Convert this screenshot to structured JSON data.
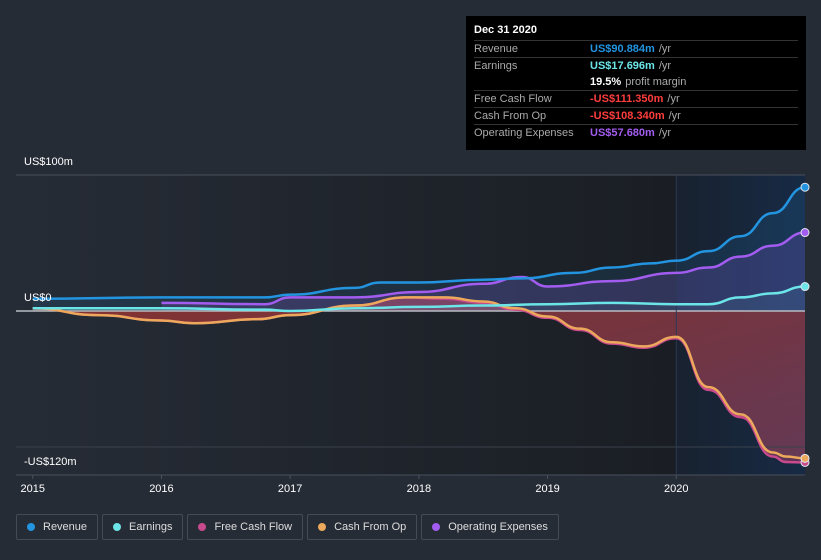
{
  "tooltip": {
    "date": "Dec 31 2020",
    "rows": [
      {
        "label": "Revenue",
        "value": "US$90.884m",
        "unit": "/yr",
        "color": "#2394df"
      },
      {
        "label": "Earnings",
        "value": "US$17.696m",
        "unit": "/yr",
        "color": "#6ce5e8"
      },
      {
        "label": "",
        "value": "19.5%",
        "unit": "profit margin",
        "color": "#ffffff"
      },
      {
        "label": "Free Cash Flow",
        "value": "-US$111.350m",
        "unit": "/yr",
        "color": "#ff3d3d"
      },
      {
        "label": "Cash From Op",
        "value": "-US$108.340m",
        "unit": "/yr",
        "color": "#ff3d3d"
      },
      {
        "label": "Operating Expenses",
        "value": "US$57.680m",
        "unit": "/yr",
        "color": "#a35cf0"
      }
    ]
  },
  "chart_data": {
    "type": "line",
    "title": "",
    "xlabel": "",
    "ylabel": "",
    "y_tick_labels": [
      "US$100m",
      "US$0",
      "-US$120m"
    ],
    "x_tick_labels": [
      "2015",
      "2016",
      "2017",
      "2018",
      "2019",
      "2020"
    ],
    "xlim": [
      2014.87,
      2021.0
    ],
    "ylim": [
      -120,
      100
    ],
    "forecast_shade_from": 2020.0,
    "series": [
      {
        "name": "Revenue",
        "color": "#2394df",
        "x": [
          2015.0,
          2016.0,
          2016.8,
          2017.0,
          2017.5,
          2017.7,
          2018.0,
          2018.5,
          2018.8,
          2019.2,
          2019.5,
          2019.8,
          2020.0,
          2020.25,
          2020.5,
          2020.75,
          2021.0
        ],
        "values": [
          9,
          10,
          10,
          12,
          17,
          21,
          21,
          23,
          24,
          28,
          32,
          35,
          37,
          44,
          55,
          72,
          91
        ]
      },
      {
        "name": "Earnings",
        "color": "#6ce5e8",
        "x": [
          2015.0,
          2016.0,
          2016.8,
          2017.0,
          2017.5,
          2018.0,
          2018.5,
          2019.0,
          2019.5,
          2020.0,
          2020.25,
          2020.5,
          2020.75,
          2021.0
        ],
        "values": [
          2,
          2,
          1,
          0,
          2,
          3,
          4,
          5,
          6,
          5,
          5,
          10,
          13,
          18
        ]
      },
      {
        "name": "Free Cash Flow",
        "color": "#c84a8c",
        "x": [
          2015.0,
          2015.5,
          2016.0,
          2016.25,
          2016.75,
          2017.0,
          2017.5,
          2017.9,
          2018.2,
          2018.5,
          2018.75,
          2019.0,
          2019.25,
          2019.5,
          2019.75,
          2020.0,
          2020.25,
          2020.5,
          2020.75,
          2020.85,
          2021.0
        ],
        "values": [
          2,
          -3,
          -7,
          -9,
          -6,
          -3,
          4,
          10,
          9,
          6,
          1,
          -5,
          -14,
          -24,
          -27,
          -20,
          -58,
          -78,
          -107,
          -111,
          -111.35
        ]
      },
      {
        "name": "Cash From Op",
        "color": "#eda95b",
        "x": [
          2015.0,
          2015.5,
          2016.0,
          2016.25,
          2016.75,
          2017.0,
          2017.5,
          2017.9,
          2018.2,
          2018.5,
          2018.75,
          2019.0,
          2019.25,
          2019.5,
          2019.75,
          2020.0,
          2020.25,
          2020.5,
          2020.75,
          2020.85,
          2021.0
        ],
        "values": [
          2,
          -3,
          -7,
          -9,
          -6,
          -3,
          4,
          10,
          10,
          7,
          2,
          -4,
          -13,
          -23,
          -26,
          -19,
          -56,
          -76,
          -104,
          -107,
          -108.34
        ]
      },
      {
        "name": "Operating Expenses",
        "color": "#a35cf0",
        "x": [
          2016.0,
          2016.8,
          2017.0,
          2017.5,
          2018.0,
          2018.5,
          2018.8,
          2019.0,
          2019.5,
          2020.0,
          2020.25,
          2020.5,
          2020.75,
          2021.0
        ],
        "values": [
          6,
          5,
          10,
          10,
          14,
          20,
          25,
          18,
          22,
          28,
          32,
          40,
          48,
          57.7
        ]
      }
    ]
  },
  "legend": [
    {
      "label": "Revenue",
      "color": "#2394df"
    },
    {
      "label": "Earnings",
      "color": "#6ce5e8"
    },
    {
      "label": "Free Cash Flow",
      "color": "#c84a8c"
    },
    {
      "label": "Cash From Op",
      "color": "#eda95b"
    },
    {
      "label": "Operating Expenses",
      "color": "#a35cf0"
    }
  ]
}
